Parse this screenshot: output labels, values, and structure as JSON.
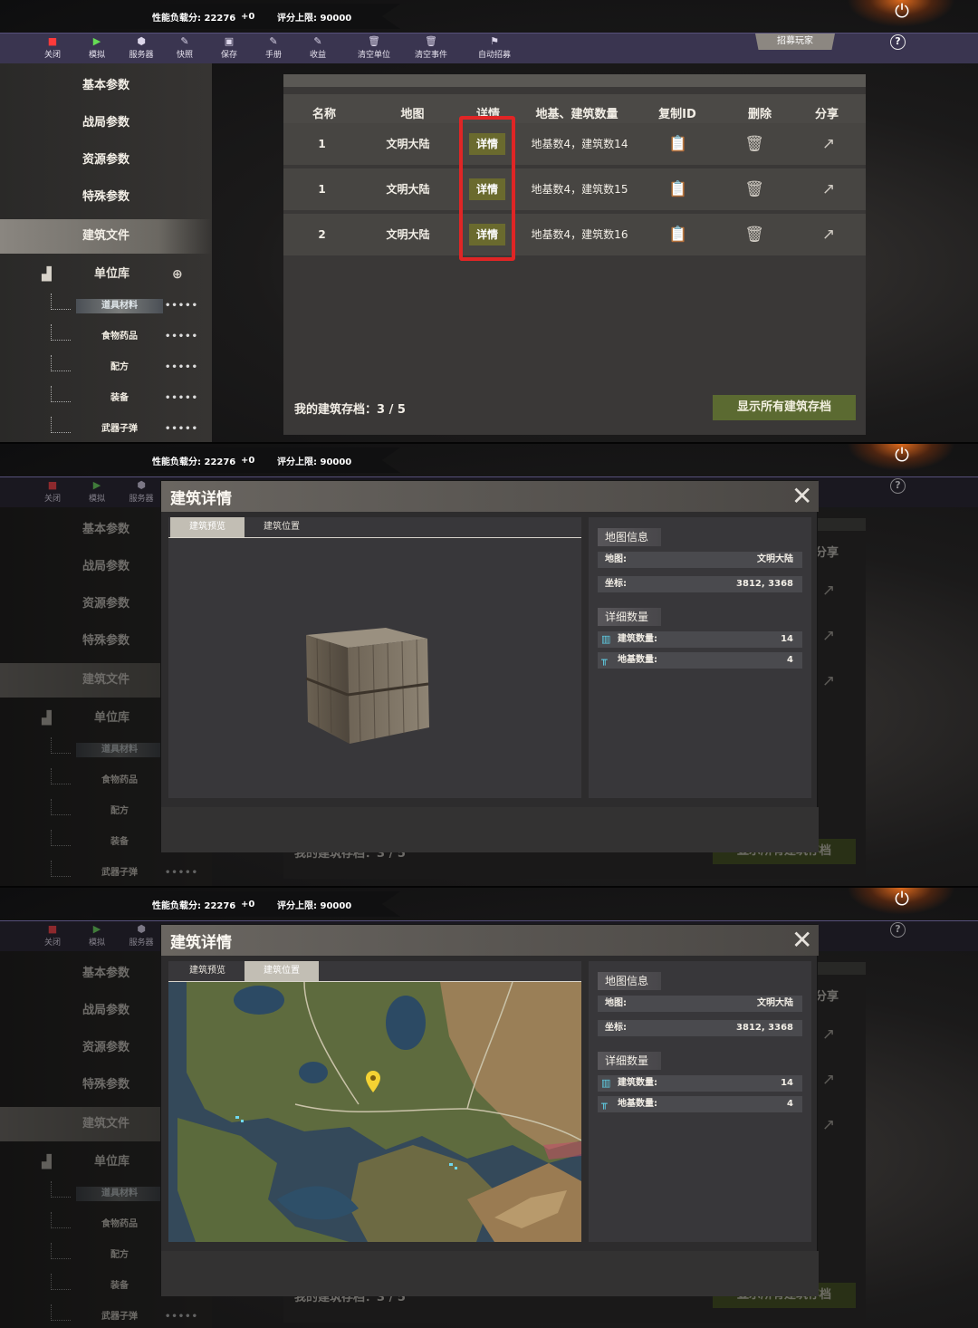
{
  "status": {
    "load_label": "性能负载分: 22276",
    "delta": "+0",
    "limit_label": "评分上限: 90000"
  },
  "toolbar": {
    "items": [
      {
        "label": "关闭",
        "icon": "stop-icon"
      },
      {
        "label": "模拟",
        "icon": "play-icon"
      },
      {
        "label": "服务器",
        "icon": "server-icon"
      },
      {
        "label": "快照",
        "icon": "snapshot-icon"
      },
      {
        "label": "保存",
        "icon": "save-icon"
      },
      {
        "label": "手册",
        "icon": "manual-icon"
      },
      {
        "label": "收益",
        "icon": "income-icon"
      },
      {
        "label": "清空单位",
        "icon": "clear-units-icon"
      },
      {
        "label": "清空事件",
        "icon": "clear-events-icon"
      },
      {
        "label": "自动招募",
        "icon": "auto-recruit-icon"
      }
    ],
    "recruit": "招募玩家",
    "help": "?"
  },
  "sidebar": {
    "items": [
      "基本参数",
      "战局参数",
      "资源参数",
      "特殊参数",
      "建筑文件"
    ],
    "unit_lib": "单位库",
    "subs": [
      "道具材料",
      "食物药品",
      "配方",
      "装备",
      "武器子弹"
    ],
    "dots": "•••••"
  },
  "table": {
    "headers": [
      "名称",
      "地图",
      "详情",
      "地基、建筑数量",
      "复制ID",
      "删除",
      "分享"
    ],
    "rows": [
      {
        "name": "1",
        "map": "文明大陆",
        "detail": "详情",
        "counts": "地基数4，建筑数14"
      },
      {
        "name": "1",
        "map": "文明大陆",
        "detail": "详情",
        "counts": "地基数4，建筑数15"
      },
      {
        "name": "2",
        "map": "文明大陆",
        "detail": "详情",
        "counts": "地基数4，建筑数16"
      }
    ],
    "archive_count": "我的建筑存档：3 / 5",
    "show_all": "显示所有建筑存档"
  },
  "modal": {
    "title": "建筑详情",
    "close": "✕",
    "tabs": [
      "建筑预览",
      "建筑位置"
    ],
    "map_info_title": "地图信息",
    "map_label": "地图:",
    "map_value": "文明大陆",
    "coord_label": "坐标:",
    "coord_value": "3812, 3368",
    "detail_title": "详细数量",
    "building_label": "建筑数量:",
    "building_value": "14",
    "foundation_label": "地基数量:",
    "foundation_value": "4"
  },
  "colors": {
    "accent_red": "#e02525",
    "detail_btn": "#6a6a2e",
    "show_all_btn": "#5b6a31",
    "toolbar": "#3a3550"
  }
}
